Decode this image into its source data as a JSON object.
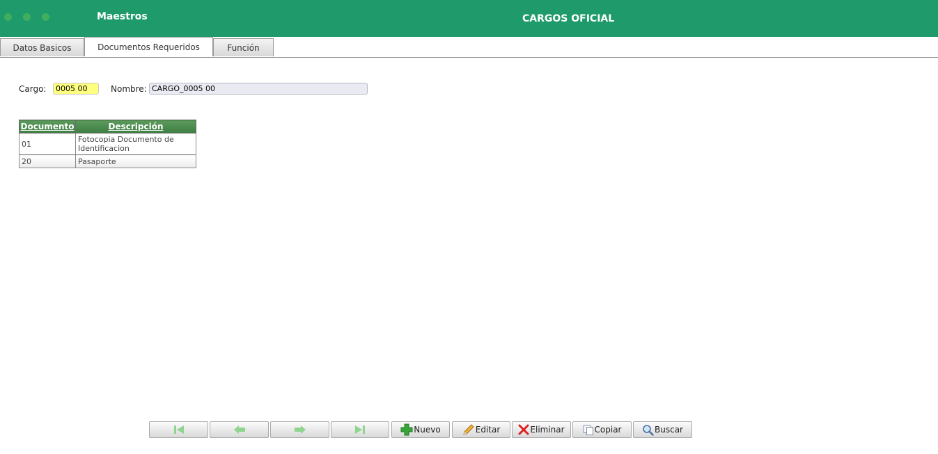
{
  "header": {
    "app_title": "Maestros",
    "page_title": "CARGOS OFICIAL"
  },
  "tabs": [
    {
      "label": "Datos Basicos",
      "active": false
    },
    {
      "label": "Documentos Requeridos",
      "active": true
    },
    {
      "label": "Función",
      "active": false
    }
  ],
  "form": {
    "cargo_label": "Cargo:",
    "cargo_value": "0005 00",
    "nombre_label": "Nombre:",
    "nombre_value": "CARGO_0005 00"
  },
  "table": {
    "headers": [
      "Documento",
      "Descripción"
    ],
    "rows": [
      [
        "01",
        "Fotocopia Documento de Identificacion"
      ],
      [
        "20",
        "Pasaporte"
      ]
    ]
  },
  "toolbar": {
    "first_icon": "first-record-icon",
    "prev_icon": "arrow-left-icon",
    "next_icon": "arrow-right-icon",
    "last_icon": "last-record-icon",
    "nuevo_label": "Nuevo",
    "editar_label": "Editar",
    "eliminar_label": "Eliminar",
    "copiar_label": "Copiar",
    "buscar_label": "Buscar"
  },
  "colors": {
    "header_bg": "#1f9b6b",
    "table_header_bg": "#4a8a4e",
    "cargo_highlight": "#ffff80",
    "nav_arrow": "#8fd48f"
  }
}
